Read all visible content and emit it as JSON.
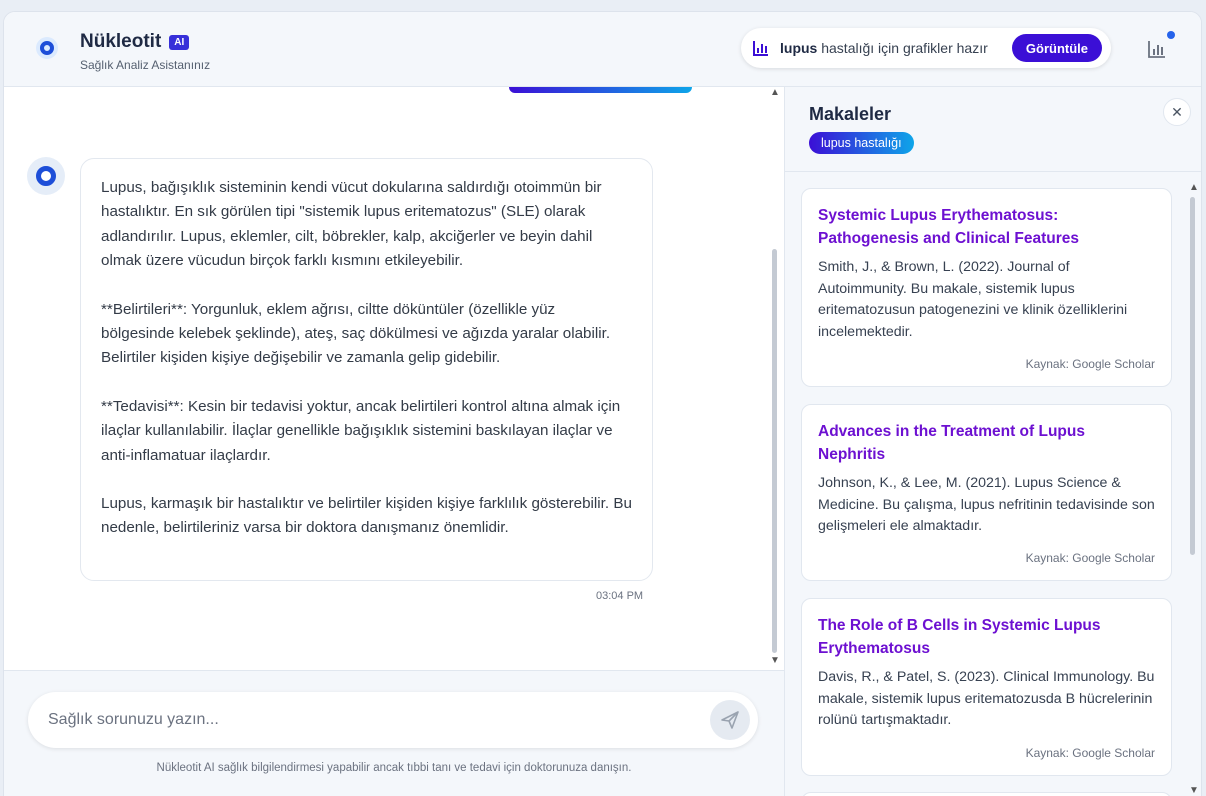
{
  "header": {
    "title": "Nükleotit",
    "badge": "AI",
    "subtitle": "Sağlık Analiz Asistanınız",
    "notification": {
      "keyword": "lupus",
      "text": " hastalığı için grafikler hazır",
      "button": "Görüntüle"
    }
  },
  "chat": {
    "message": {
      "paragraphs": [
        "Lupus, bağışıklık sisteminin kendi vücut dokularına saldırdığı otoimmün bir hastalıktır. En sık görülen tipi \"sistemik lupus eritematozus\" (SLE) olarak adlandırılır. Lupus, eklemler, cilt, böbrekler, kalp, akciğerler ve beyin dahil olmak üzere vücudun birçok farklı kısmını etkileyebilir.",
        "**Belirtileri**: Yorgunluk, eklem ağrısı, ciltte döküntüler (özellikle yüz bölgesinde kelebek şeklinde), ateş, saç dökülmesi ve ağızda yaralar olabilir. Belirtiler kişiden kişiye değişebilir ve zamanla gelip gidebilir.",
        "**Tedavisi**: Kesin bir tedavisi yoktur, ancak belirtileri kontrol altına almak için ilaçlar kullanılabilir. İlaçlar genellikle bağışıklık sistemini baskılayan ilaçlar ve anti-inflamatuar ilaçlardır.",
        "Lupus, karmaşık bir hastalıktır ve belirtiler kişiden kişiye farklılık gösterebilir. Bu nedenle, belirtileriniz varsa bir doktora danışmanız önemlidir."
      ],
      "time": "03:04 PM"
    },
    "input_placeholder": "Sağlık sorunuzu yazın...",
    "disclaimer": "Nükleotit AI sağlık bilgilendirmesi yapabilir ancak tıbbi tanı ve tedavi için doktorunuza danışın."
  },
  "panel": {
    "title": "Makaleler",
    "tag": "lupus hastalığı",
    "articles": [
      {
        "title": "Systemic Lupus Erythematosus: Pathogenesis and Clinical Features",
        "body": "Smith, J., & Brown, L. (2022). Journal of Autoimmunity. Bu makale, sistemik lupus eritematozusun patogenezini ve klinik özelliklerini incelemektedir.",
        "source": "Kaynak: Google Scholar"
      },
      {
        "title": "Advances in the Treatment of Lupus Nephritis",
        "body": "Johnson, K., & Lee, M. (2021). Lupus Science & Medicine. Bu çalışma, lupus nefritinin tedavisinde son gelişmeleri ele almaktadır.",
        "source": "Kaynak: Google Scholar"
      },
      {
        "title": "The Role of B Cells in Systemic Lupus Erythematosus",
        "body": "Davis, R., & Patel, S. (2023). Clinical Immunology. Bu makale, sistemik lupus eritematozusda B hücrelerinin rolünü tartışmaktadır.",
        "source": "Kaynak: Google Scholar"
      }
    ]
  },
  "colors": {
    "accent": "#3b0fd6",
    "article_title": "#6d10d1",
    "brand_blue": "#1d4ed8"
  }
}
